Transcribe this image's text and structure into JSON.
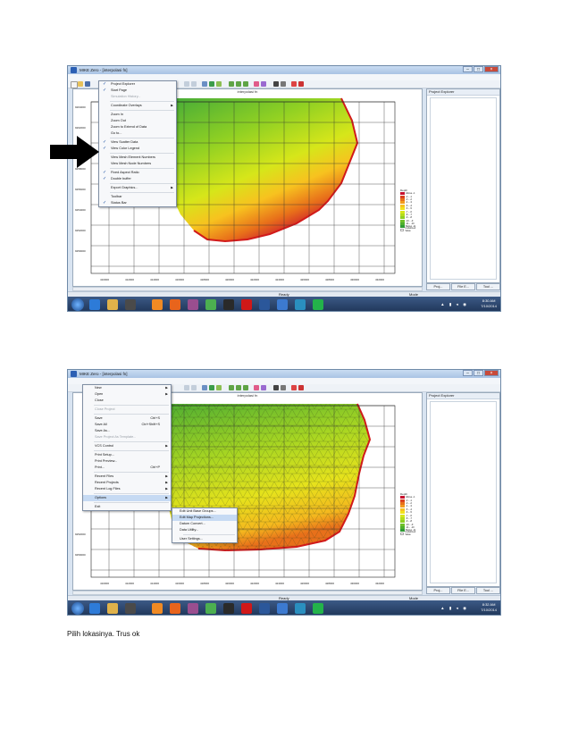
{
  "window_title": "MIKE Zero - [interpolasi fn]",
  "menubar": [
    "File",
    "Edit",
    "View",
    "Data",
    "Mesh",
    "Options",
    "Window",
    "Help"
  ],
  "map_title": "interpolasi fn",
  "explorer_title": "Project Explorer",
  "explorer_tabs": [
    "Proj...",
    "File E...",
    "Tool ..."
  ],
  "status_ready": "Ready",
  "status_mode": "Mode",
  "view_menu": [
    {
      "label": "Project Explorer",
      "checked": true
    },
    {
      "label": "Start Page",
      "checked": true
    },
    {
      "label": "Simulation History...",
      "disabled": true
    },
    {
      "sep": true
    },
    {
      "label": "Coordinate Overlays",
      "sub": true
    },
    {
      "sep": true
    },
    {
      "label": "Zoom In"
    },
    {
      "label": "Zoom Out"
    },
    {
      "label": "Zoom to Extend of Data"
    },
    {
      "label": "Go to..."
    },
    {
      "sep": true
    },
    {
      "label": "View Scatter Data",
      "checked": true
    },
    {
      "label": "View Color Legend",
      "checked": true
    },
    {
      "sep": true
    },
    {
      "label": "View Mesh Element Numbers"
    },
    {
      "label": "View Mesh Node Numbers"
    },
    {
      "sep": true
    },
    {
      "label": "Fixed Aspect Ratio",
      "checked": true
    },
    {
      "label": "Double buffer",
      "checked": true
    },
    {
      "sep": true
    },
    {
      "label": "Export Graphics...",
      "sub": true
    },
    {
      "sep": true
    },
    {
      "label": "Toolbar"
    },
    {
      "label": "Status Bar",
      "checked": true
    }
  ],
  "file_menu": [
    {
      "label": "New",
      "sub": true
    },
    {
      "label": "Open",
      "sub": true
    },
    {
      "label": "Close"
    },
    {
      "sep": true
    },
    {
      "label": "Close Project",
      "disabled": true
    },
    {
      "sep": true
    },
    {
      "label": "Save",
      "shortcut": "Ctrl+S"
    },
    {
      "label": "Save All",
      "shortcut": "Ctrl+Shift+S"
    },
    {
      "label": "Save As..."
    },
    {
      "label": "Save Project As Template...",
      "disabled": true
    },
    {
      "sep": true
    },
    {
      "label": "VCS Control",
      "sub": true
    },
    {
      "sep": true
    },
    {
      "label": "Print Setup..."
    },
    {
      "label": "Print Preview..."
    },
    {
      "label": "Print...",
      "shortcut": "Ctrl+P"
    },
    {
      "sep": true
    },
    {
      "label": "Recent Files",
      "sub": true
    },
    {
      "label": "Recent Projects",
      "sub": true
    },
    {
      "label": "Recent Log Files",
      "sub": true
    },
    {
      "sep": true
    },
    {
      "label": "Options",
      "sub": true,
      "highlight": true
    },
    {
      "sep": true
    },
    {
      "label": "Exit"
    }
  ],
  "options_submenu": [
    {
      "label": "Edit Unit Base Groups..."
    },
    {
      "label": "Edit Map Projections...",
      "highlight": true
    },
    {
      "label": "Datum Convert..."
    },
    {
      "label": "Data Utility..."
    },
    {
      "sep": true
    },
    {
      "label": "User Settings..."
    }
  ],
  "legend": {
    "title": "Depth",
    "items": [
      {
        "label": "Above -1",
        "color": "#c8102e"
      },
      {
        "label": "-2 - -1",
        "color": "#d9401e"
      },
      {
        "label": "-3 - -2",
        "color": "#e8701a"
      },
      {
        "label": "-4 - -3",
        "color": "#f29a1d"
      },
      {
        "label": "-5 - -4",
        "color": "#f7c21f"
      },
      {
        "label": "-6 - -5",
        "color": "#f2e21c"
      },
      {
        "label": "-7 - -6",
        "color": "#d6e61a"
      },
      {
        "label": "-8 - -7",
        "color": "#b3dc1c"
      },
      {
        "label": "-9 - -8",
        "color": "#8fd023"
      },
      {
        "label": "-10 - -9",
        "color": "#6ec02a"
      },
      {
        "label": "-11 - -10",
        "color": "#4faf2f"
      },
      {
        "label": "Below -11",
        "color": "#2f9a34"
      },
      {
        "label": "Undefined Value",
        "color": "#ffffff"
      }
    ]
  },
  "y_ticks": [
    "9264000",
    "9262000",
    "9260000",
    "9258000",
    "9256000",
    "9254000",
    "9252000",
    "9250000",
    "9248000"
  ],
  "x_ticks": [
    "410000",
    "412000",
    "414000",
    "416000",
    "418000",
    "420000",
    "422000",
    "424000",
    "426000",
    "428000",
    "430000",
    "432000"
  ],
  "clock1": {
    "time": "8:30 AM",
    "date": "7/10/2014"
  },
  "clock2": {
    "time": "8:32 AM",
    "date": "7/10/2014"
  },
  "caption": "Pilih lokasinya. Trus ok"
}
